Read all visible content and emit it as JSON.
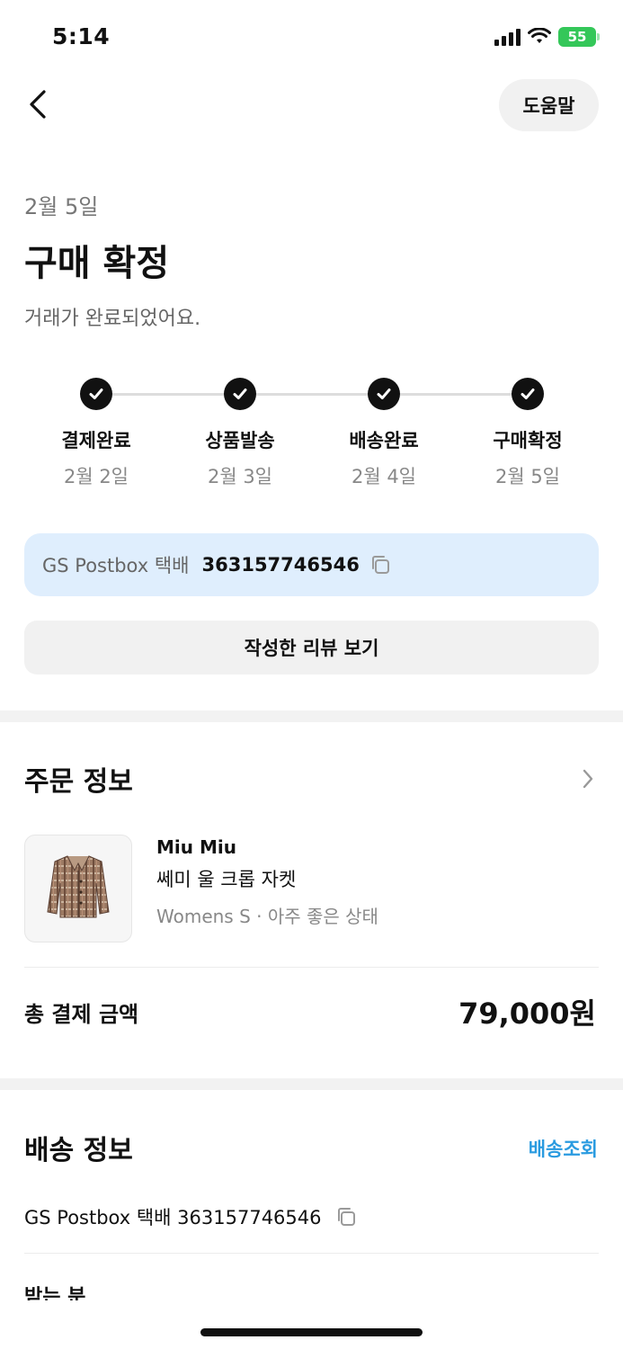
{
  "status_bar": {
    "time": "5:14",
    "battery": "55"
  },
  "header": {
    "help_label": "도움말"
  },
  "summary": {
    "date": "2월 5일",
    "title": "구매 확정",
    "subtitle": "거래가 완료되었어요."
  },
  "steps": [
    {
      "label": "결제완료",
      "date": "2월 2일"
    },
    {
      "label": "상품발송",
      "date": "2월 3일"
    },
    {
      "label": "배송완료",
      "date": "2월 4일"
    },
    {
      "label": "구매확정",
      "date": "2월 5일"
    }
  ],
  "tracking": {
    "carrier": "GS Postbox 택배",
    "number": "363157746546"
  },
  "review_button_label": "작성한 리뷰 보기",
  "order": {
    "section_title": "주문 정보",
    "brand": "Miu Miu",
    "product_name": "쎄미 울 크롭 자켓",
    "product_meta": "Womens S · 아주 좋은 상태",
    "total_label": "총 결제 금액",
    "total_value": "79,000원"
  },
  "shipping": {
    "section_title": "배송 정보",
    "track_link": "배송조회",
    "line": "GS Postbox 택배 363157746546",
    "recipient_label": "받는 분"
  },
  "colors": {
    "accent_link": "#2a9be0",
    "tracking_bg": "#dfeefd",
    "check": "#111111"
  }
}
